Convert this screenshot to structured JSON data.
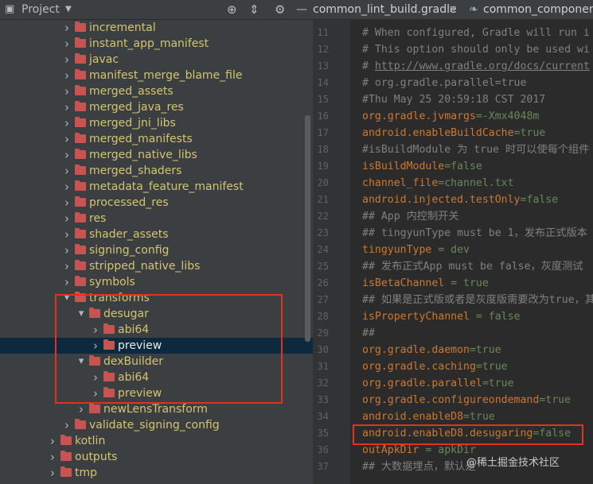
{
  "topbar": {
    "project_label": "Project",
    "tab1": "common_lint_build.gradle",
    "tab2": "common_component"
  },
  "tree": [
    {
      "depth": 4,
      "label": "incremental",
      "expanded": false
    },
    {
      "depth": 4,
      "label": "instant_app_manifest",
      "expanded": false
    },
    {
      "depth": 4,
      "label": "javac",
      "expanded": false
    },
    {
      "depth": 4,
      "label": "manifest_merge_blame_file",
      "expanded": false
    },
    {
      "depth": 4,
      "label": "merged_assets",
      "expanded": false
    },
    {
      "depth": 4,
      "label": "merged_java_res",
      "expanded": false
    },
    {
      "depth": 4,
      "label": "merged_jni_libs",
      "expanded": false
    },
    {
      "depth": 4,
      "label": "merged_manifests",
      "expanded": false
    },
    {
      "depth": 4,
      "label": "merged_native_libs",
      "expanded": false
    },
    {
      "depth": 4,
      "label": "merged_shaders",
      "expanded": false
    },
    {
      "depth": 4,
      "label": "metadata_feature_manifest",
      "expanded": false
    },
    {
      "depth": 4,
      "label": "processed_res",
      "expanded": false
    },
    {
      "depth": 4,
      "label": "res",
      "expanded": false
    },
    {
      "depth": 4,
      "label": "shader_assets",
      "expanded": false
    },
    {
      "depth": 4,
      "label": "signing_config",
      "expanded": false
    },
    {
      "depth": 4,
      "label": "stripped_native_libs",
      "expanded": false
    },
    {
      "depth": 4,
      "label": "symbols",
      "expanded": false
    },
    {
      "depth": 4,
      "label": "transforms",
      "expanded": true
    },
    {
      "depth": 5,
      "label": "desugar",
      "expanded": true
    },
    {
      "depth": 6,
      "label": "abi64",
      "expanded": false
    },
    {
      "depth": 6,
      "label": "preview",
      "expanded": false,
      "selected": true
    },
    {
      "depth": 5,
      "label": "dexBuilder",
      "expanded": true
    },
    {
      "depth": 6,
      "label": "abi64",
      "expanded": false
    },
    {
      "depth": 6,
      "label": "preview",
      "expanded": false
    },
    {
      "depth": 5,
      "label": "newLensTransform",
      "expanded": false
    },
    {
      "depth": 4,
      "label": "validate_signing_config",
      "expanded": false
    },
    {
      "depth": 3,
      "label": "kotlin",
      "expanded": false
    },
    {
      "depth": 3,
      "label": "outputs",
      "expanded": false
    },
    {
      "depth": 3,
      "label": "tmp",
      "expanded": false
    }
  ],
  "line_numbers": [
    "11",
    "12",
    "13",
    "14",
    "15",
    "16",
    "17",
    "18",
    "19",
    "20",
    "21",
    "22",
    "23",
    "24",
    "25",
    "26",
    "27",
    "28",
    "29",
    "30",
    "31",
    "32",
    "33",
    "34",
    "35",
    "36",
    "37"
  ],
  "code": [
    [
      {
        "t": "# When configured, Gradle will run i",
        "c": "c"
      }
    ],
    [
      {
        "t": "# This option should only be used wi",
        "c": "c"
      }
    ],
    [
      {
        "t": "# ",
        "c": "c"
      },
      {
        "t": "http://www.gradle.org/docs/current",
        "c": "u"
      }
    ],
    [
      {
        "t": "# org.gradle.parallel=true",
        "c": "c"
      }
    ],
    [
      {
        "t": "#Thu May 25 20:59:18 CST 2017",
        "c": "c"
      }
    ],
    [
      {
        "t": "org.gradle.jvmargs",
        "c": "k"
      },
      {
        "t": "=-Xmx4048m",
        "c": "v"
      }
    ],
    [
      {
        "t": "android.enableBuildCache",
        "c": "k"
      },
      {
        "t": "=true",
        "c": "v"
      }
    ],
    [
      {
        "t": "#isBuildModule 为 true 时可以使每个组件",
        "c": "c"
      }
    ],
    [
      {
        "t": "isBuildModule",
        "c": "k"
      },
      {
        "t": "=false",
        "c": "v"
      }
    ],
    [
      {
        "t": "channel_file",
        "c": "k"
      },
      {
        "t": "=channel.txt",
        "c": "v"
      }
    ],
    [
      {
        "t": "android.injected.testOnly",
        "c": "k"
      },
      {
        "t": "=false",
        "c": "v"
      }
    ],
    [
      {
        "t": "## App 内控制开关",
        "c": "c"
      }
    ],
    [
      {
        "t": "## tingyunType must be 1，发布正式版本",
        "c": "c"
      }
    ],
    [
      {
        "t": "tingyunType",
        "c": "k"
      },
      {
        "t": " = dev",
        "c": "v"
      }
    ],
    [
      {
        "t": "## 发布正式App must be false，灰度测试",
        "c": "c"
      }
    ],
    [
      {
        "t": "isBetaChannel",
        "c": "k"
      },
      {
        "t": " = true",
        "c": "v"
      }
    ],
    [
      {
        "t": "## 如果是正式版或者是灰度版需要改为true，其",
        "c": "c"
      }
    ],
    [
      {
        "t": "isPropertyChannel",
        "c": "k"
      },
      {
        "t": " = false",
        "c": "v"
      }
    ],
    [
      {
        "t": "##",
        "c": "c"
      }
    ],
    [
      {
        "t": "org.gradle.daemon",
        "c": "k"
      },
      {
        "t": "=true",
        "c": "v"
      }
    ],
    [
      {
        "t": "org.gradle.caching",
        "c": "k"
      },
      {
        "t": "=true",
        "c": "v"
      }
    ],
    [
      {
        "t": "org.gradle.parallel",
        "c": "k"
      },
      {
        "t": "=true",
        "c": "v"
      }
    ],
    [
      {
        "t": "org.gradle.configureondemand",
        "c": "k"
      },
      {
        "t": "=true",
        "c": "v"
      }
    ],
    [
      {
        "t": "android.enableD8",
        "c": "k"
      },
      {
        "t": "=true",
        "c": "v"
      }
    ],
    [
      {
        "t": "android.enableD8.desugaring",
        "c": "k"
      },
      {
        "t": "=false",
        "c": "v"
      }
    ],
    [
      {
        "t": "outApkDir",
        "c": "k"
      },
      {
        "t": " = apkDir",
        "c": "v"
      }
    ],
    [
      {
        "t": "## 大数据埋点，默认是 ",
        "c": "c"
      }
    ]
  ],
  "watermark": "@稀土掘金技术社区",
  "colors": {
    "panel_bg": "#3c3f41",
    "editor_bg": "#2b2b2b",
    "folder": "#c75450",
    "highlight_box": "#e0321e",
    "selection": "#0d293e"
  }
}
